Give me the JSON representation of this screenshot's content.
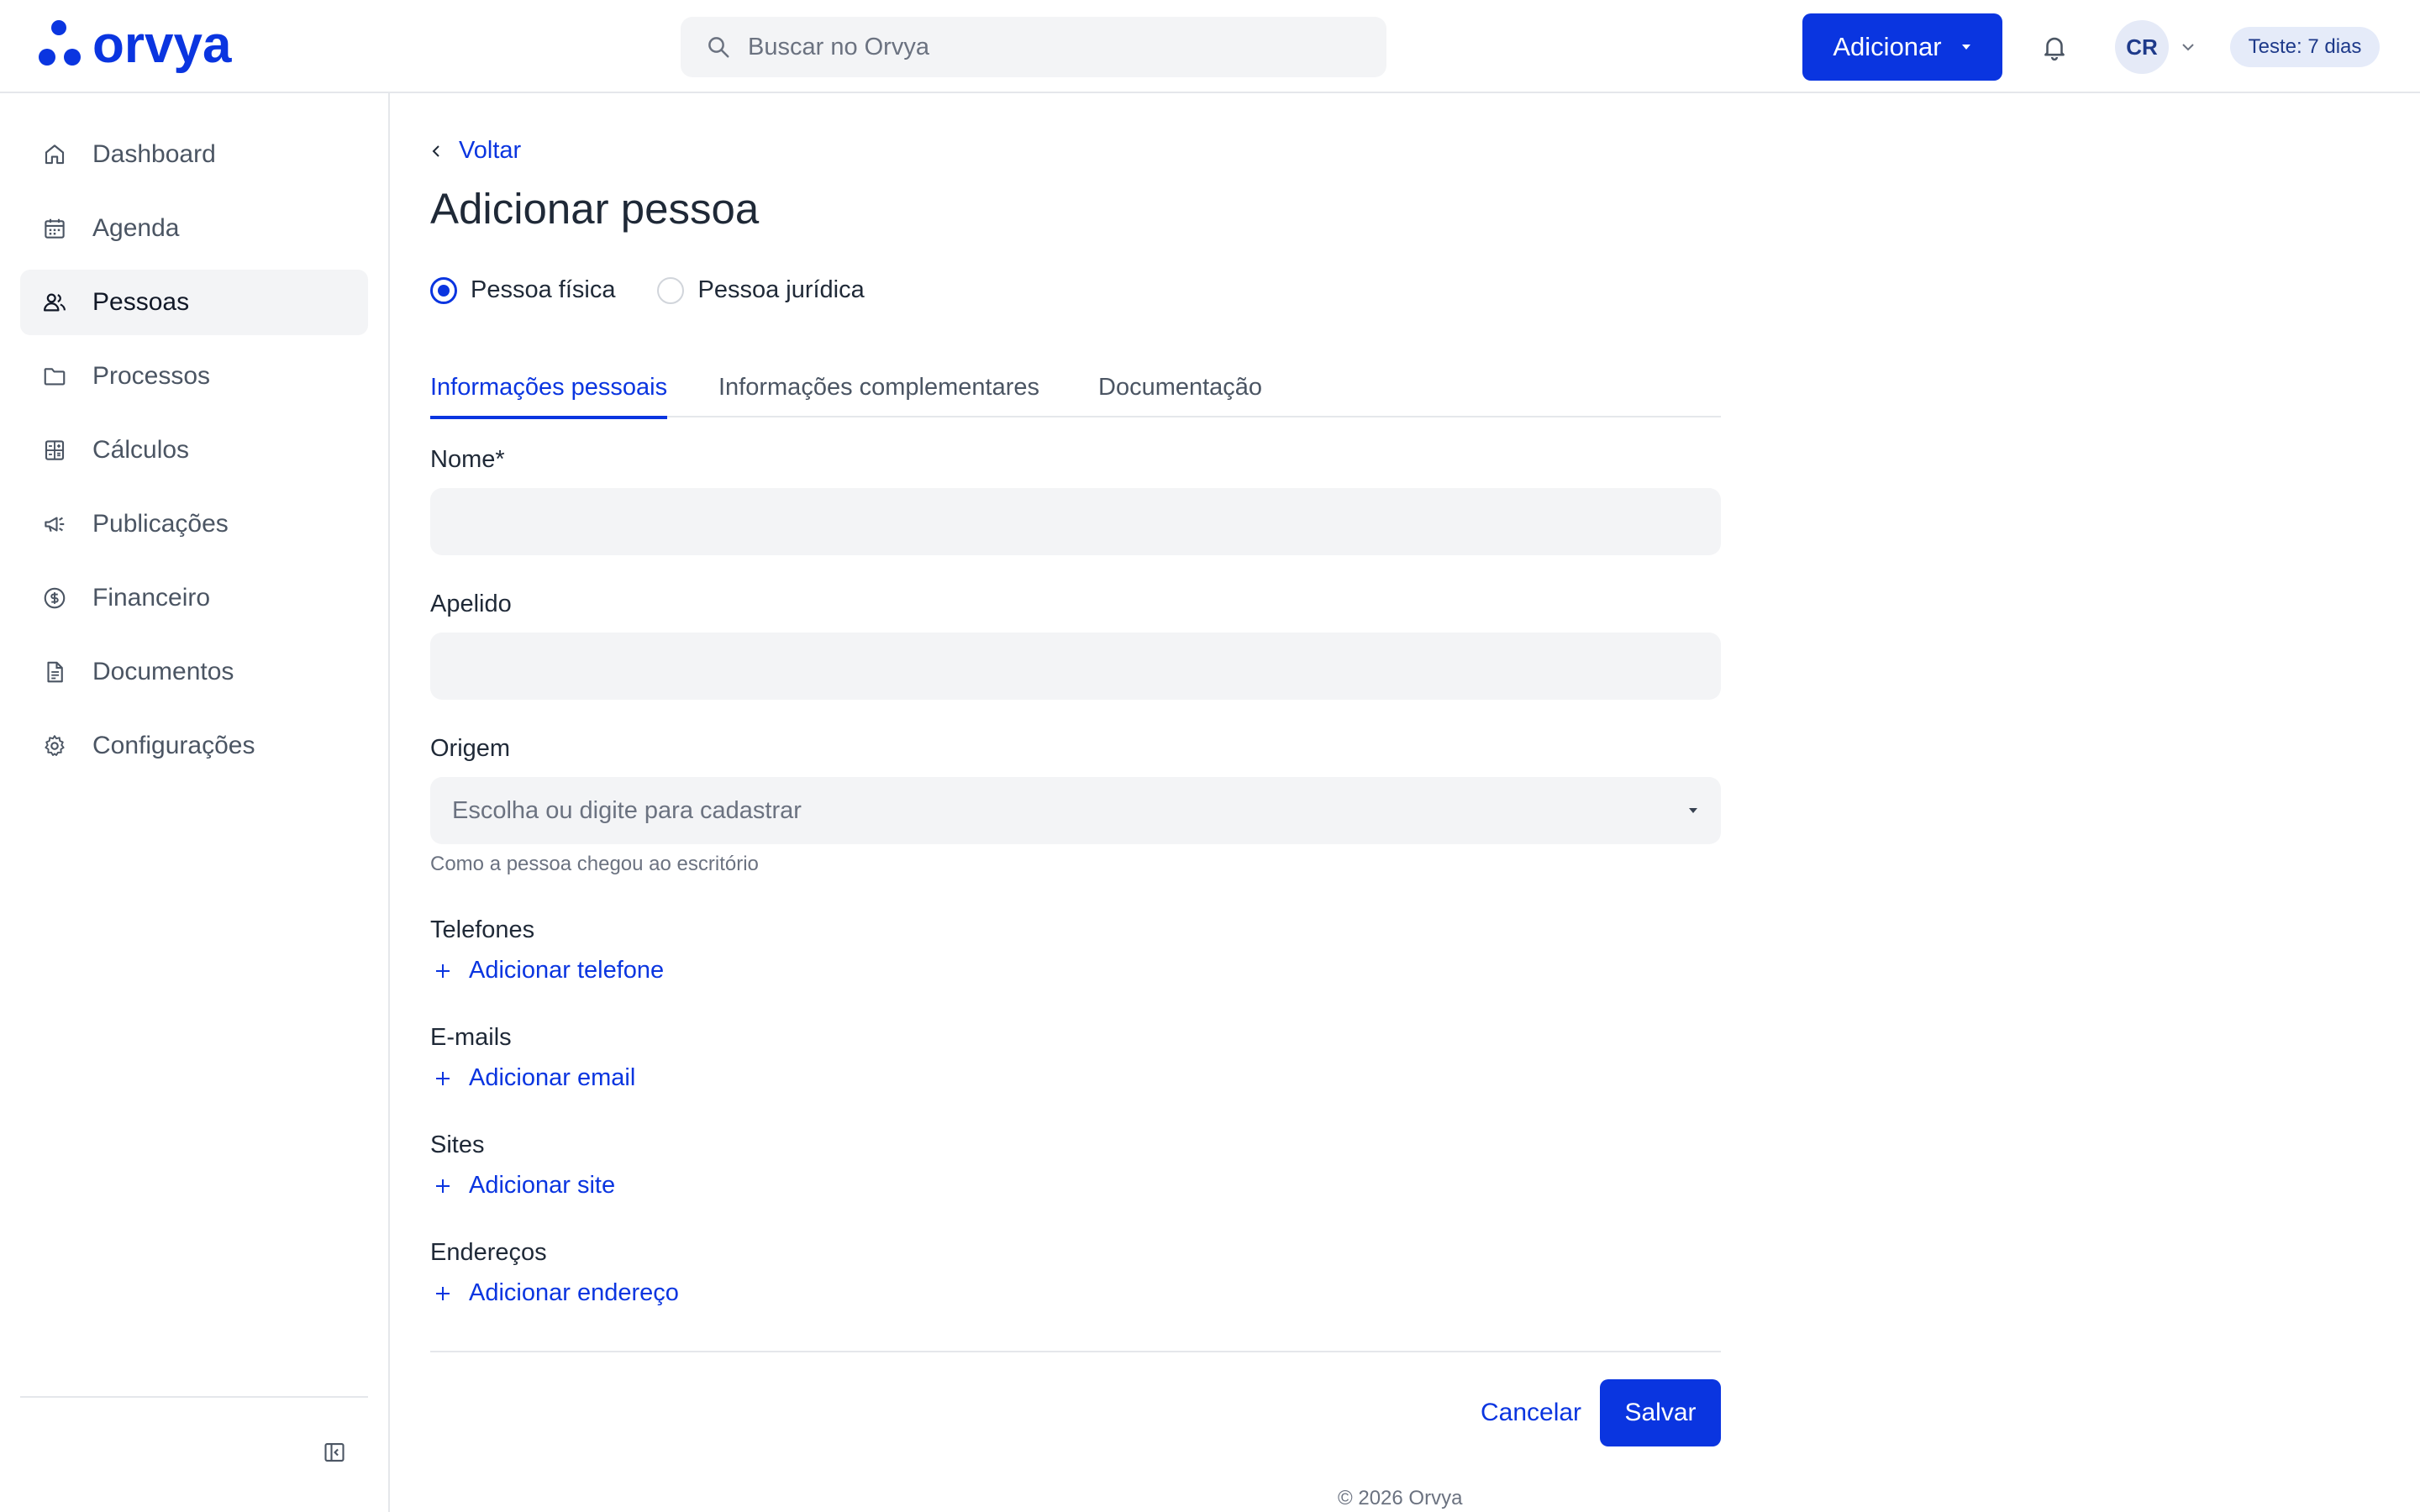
{
  "app": {
    "logo_text": "orvya",
    "brand_color": "#0a35e0"
  },
  "header": {
    "search_placeholder": "Buscar no Orvya",
    "add_button_label": "Adicionar",
    "avatar_initials": "CR",
    "trial_badge": "Teste: 7 dias"
  },
  "sidebar": {
    "items": [
      {
        "label": "Dashboard",
        "icon": "home-icon"
      },
      {
        "label": "Agenda",
        "icon": "calendar-icon"
      },
      {
        "label": "Pessoas",
        "icon": "users-icon",
        "active": true
      },
      {
        "label": "Processos",
        "icon": "folder-icon"
      },
      {
        "label": "Cálculos",
        "icon": "calculator-icon"
      },
      {
        "label": "Publicações",
        "icon": "megaphone-icon"
      },
      {
        "label": "Financeiro",
        "icon": "dollar-icon"
      },
      {
        "label": "Documentos",
        "icon": "document-icon"
      },
      {
        "label": "Configurações",
        "icon": "gear-icon"
      }
    ]
  },
  "main": {
    "back_label": "Voltar",
    "title": "Adicionar pessoa",
    "person_types": [
      {
        "label": "Pessoa física",
        "checked": true
      },
      {
        "label": "Pessoa jurídica",
        "checked": false
      }
    ],
    "tabs": [
      {
        "label": "Informações pessoais",
        "active": true
      },
      {
        "label": "Informações complementares",
        "active": false
      },
      {
        "label": "Documentação",
        "active": false
      }
    ],
    "form": {
      "name_label": "Nome*",
      "name_value": "",
      "nickname_label": "Apelido",
      "nickname_value": "",
      "origin_label": "Origem",
      "origin_placeholder": "Escolha ou digite para cadastrar",
      "origin_helper": "Como a pessoa chegou ao escritório",
      "phones_label": "Telefones",
      "phones_add": "Adicionar telefone",
      "emails_label": "E-mails",
      "emails_add": "Adicionar email",
      "sites_label": "Sites",
      "sites_add": "Adicionar site",
      "addresses_label": "Endereços",
      "addresses_add": "Adicionar endereço"
    },
    "cancel_label": "Cancelar",
    "save_label": "Salvar"
  },
  "footer": {
    "copyright": "© 2026 Orvya"
  }
}
